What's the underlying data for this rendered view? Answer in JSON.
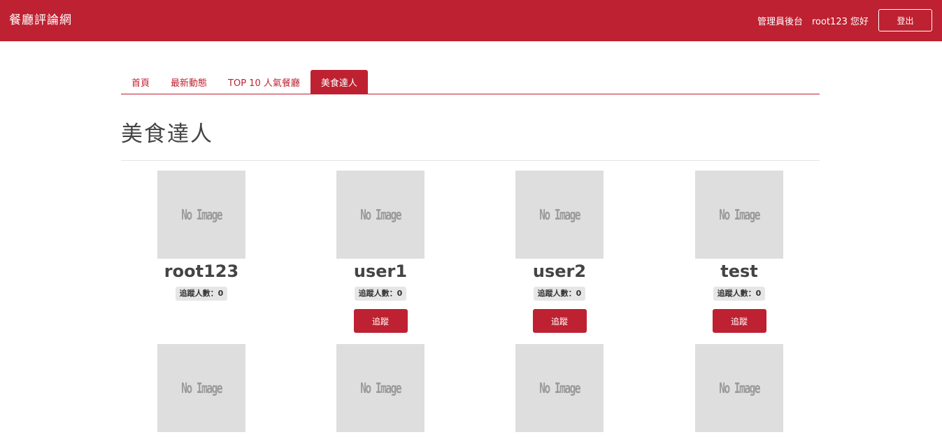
{
  "header": {
    "brand": "餐廳評論網",
    "admin_link": "管理員後台",
    "greeting": "root123 您好",
    "logout": "登出"
  },
  "tabs": [
    {
      "label": "首頁",
      "active": false
    },
    {
      "label": "最新動態",
      "active": false
    },
    {
      "label": "TOP 10 人氣餐廳",
      "active": false
    },
    {
      "label": "美食達人",
      "active": true
    }
  ],
  "page_title": "美食達人",
  "users_row1": [
    {
      "name": "root123",
      "avatar_text": "No Image",
      "followers": "追蹤人數：0",
      "button": null
    },
    {
      "name": "user1",
      "avatar_text": "No Image",
      "followers": "追蹤人數：0",
      "button": "追蹤"
    },
    {
      "name": "user2",
      "avatar_text": "No Image",
      "followers": "追蹤人數：0",
      "button": "追蹤"
    },
    {
      "name": "test",
      "avatar_text": "No Image",
      "followers": "追蹤人數：0",
      "button": "追蹤"
    }
  ],
  "users_row2": [
    {
      "avatar_text": "No Image"
    },
    {
      "avatar_text": "No Image"
    },
    {
      "avatar_text": "No Image"
    },
    {
      "avatar_text": "No Image"
    }
  ],
  "colors": {
    "brand_red": "#be2131",
    "avatar_gray": "#dedede"
  }
}
